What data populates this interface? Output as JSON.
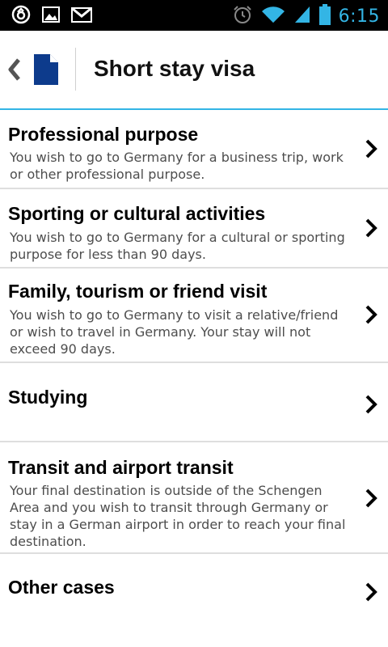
{
  "status_bar": {
    "time": "6:15",
    "left_icons": [
      "sync-icon",
      "image-icon",
      "gmail-icon"
    ],
    "right_icons": [
      "alarm-icon",
      "wifi-icon",
      "signal-icon",
      "battery-icon"
    ]
  },
  "action_bar": {
    "title": "Short stay visa",
    "icons": [
      "back-chevron-icon",
      "document-icon"
    ]
  },
  "list": {
    "items": [
      {
        "title": "Professional purpose",
        "description": "You wish to go to Germany for a business trip, work or other professional purpose."
      },
      {
        "title": "Sporting or cultural activities",
        "description": "You wish to go to Germany for a cultural or sporting purpose for less than 90 days."
      },
      {
        "title": "Family, tourism or friend visit",
        "description": "You wish to go to Germany to visit a relative/friend or wish to travel in Germany. Your stay will not exceed 90 days."
      },
      {
        "title": "Studying",
        "description": ""
      },
      {
        "title": "Transit and airport transit",
        "description": "Your final destination is outside of the Schengen Area and you wish to transit through Germany or stay in a German airport in order to reach your final destination."
      },
      {
        "title": "Other cases",
        "description": ""
      }
    ]
  },
  "colors": {
    "status_bar_bg": "#000000",
    "accent": "#33b5e5",
    "text_primary": "#000000",
    "text_secondary": "#4d4d4d",
    "divider": "#dedede"
  }
}
